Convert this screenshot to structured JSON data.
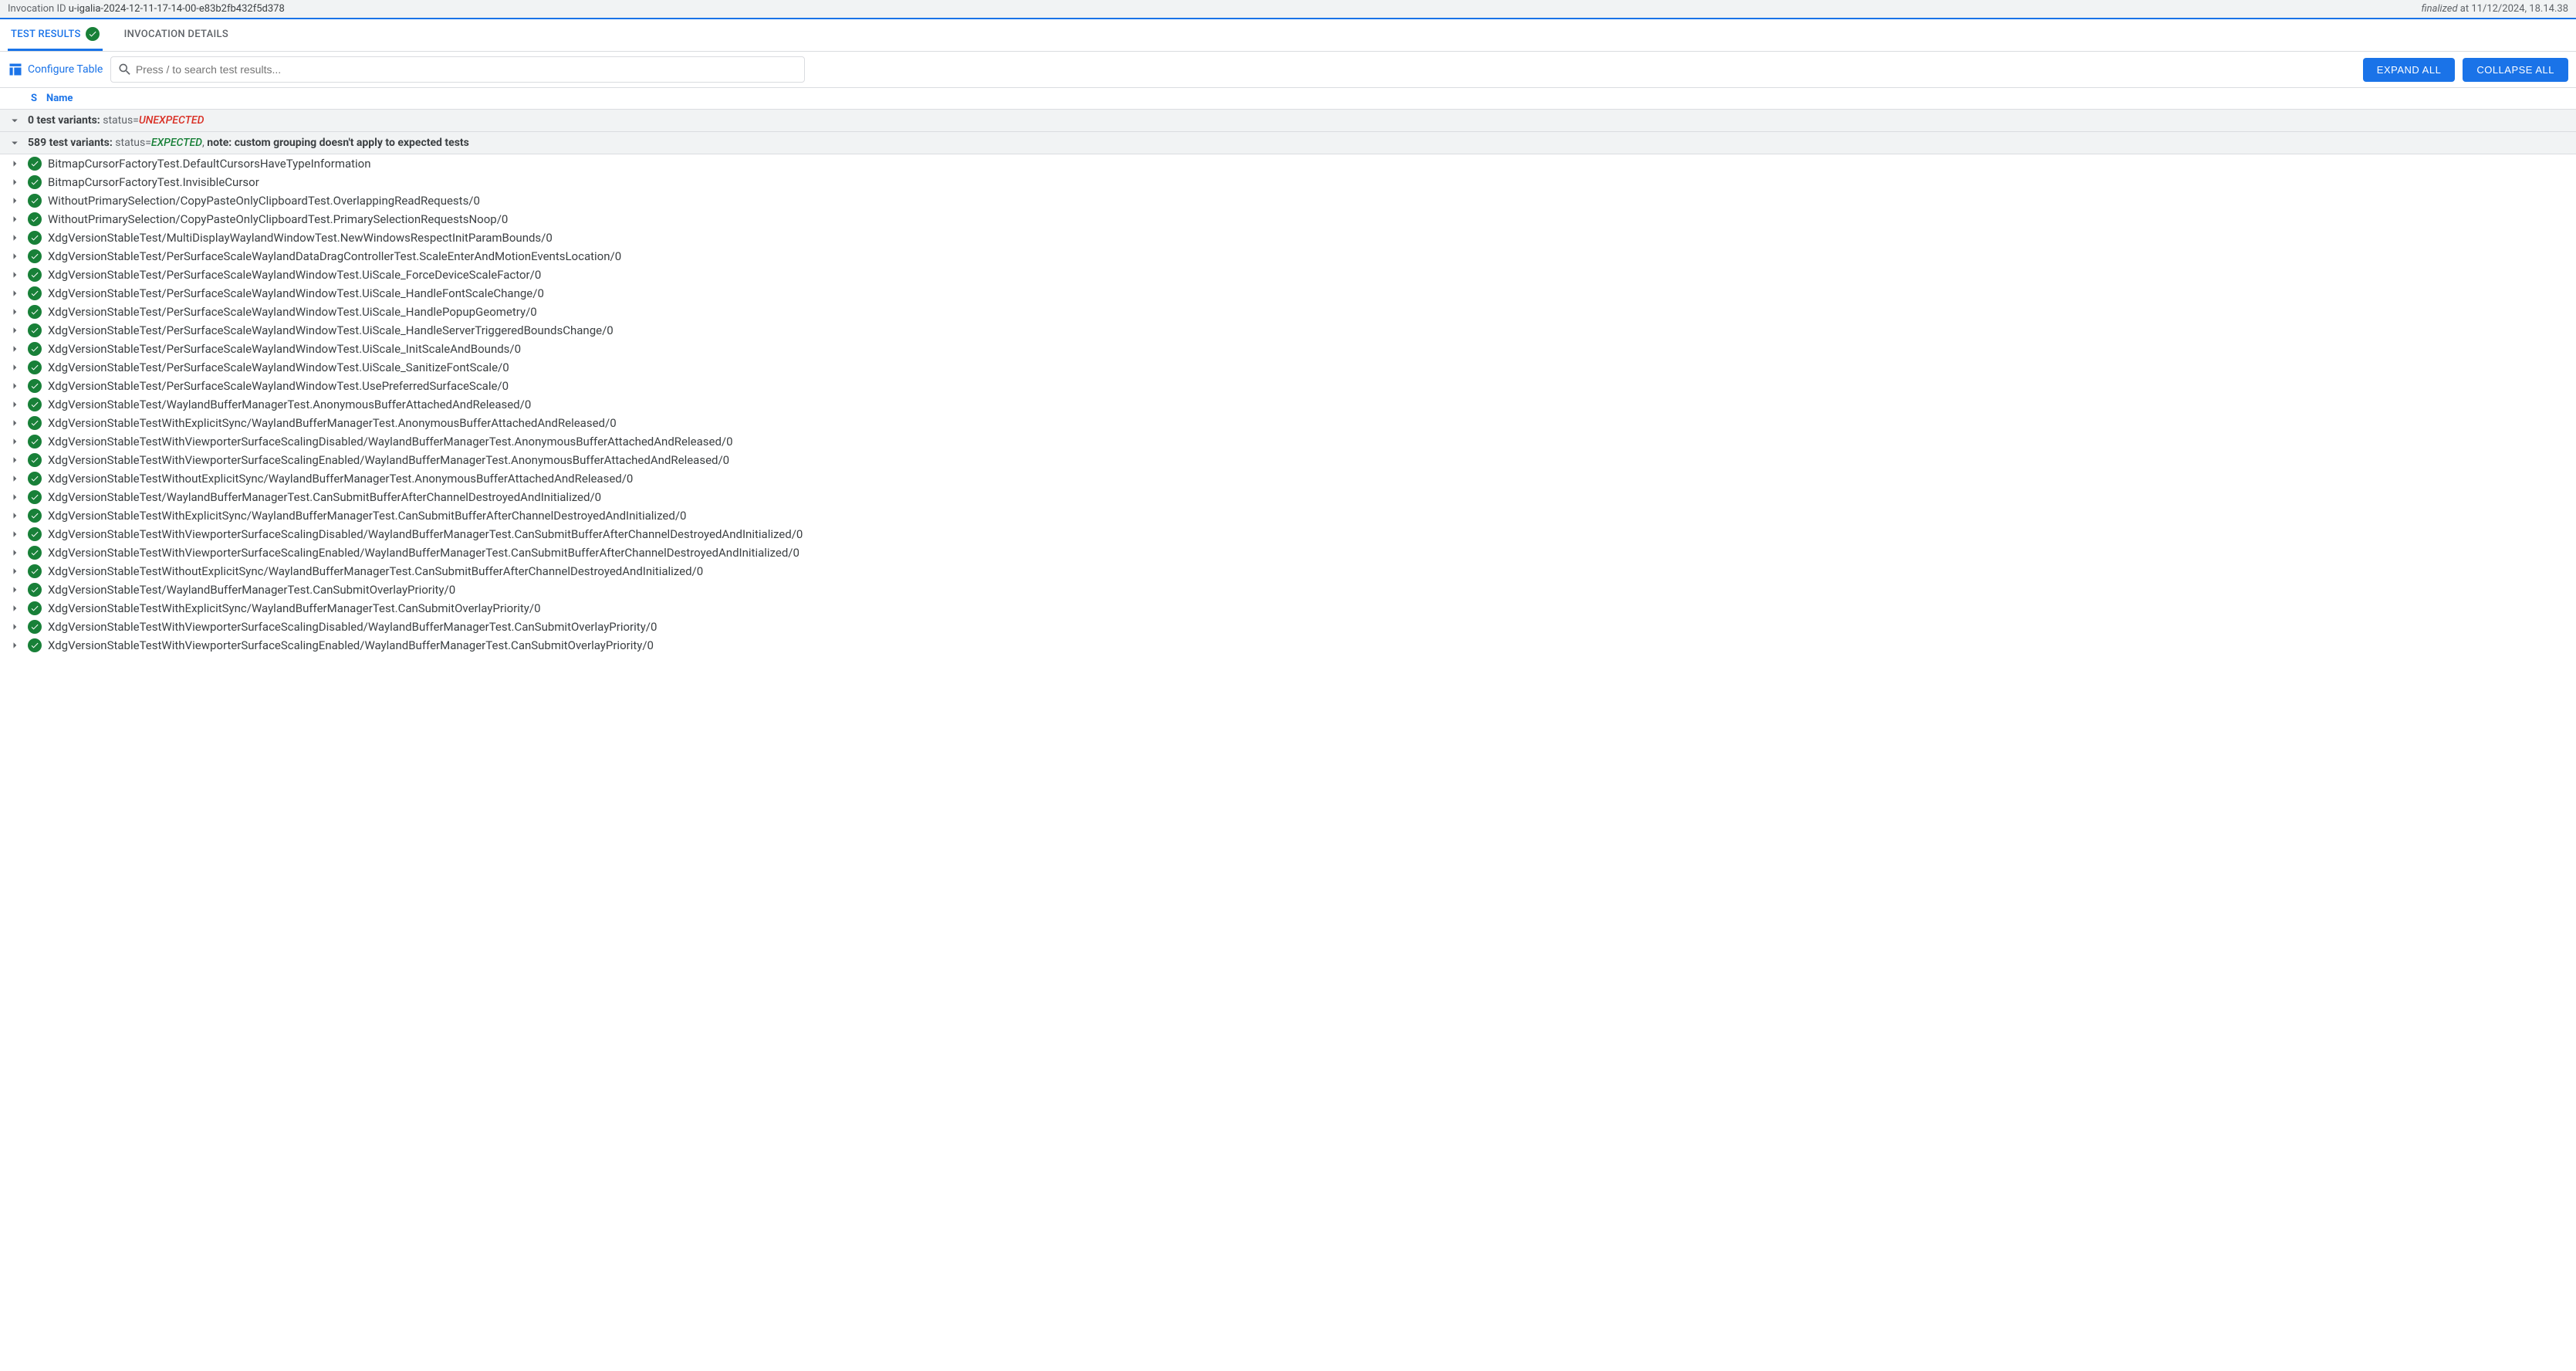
{
  "header": {
    "invocation_label": "Invocation ID",
    "invocation_id": "u-igalia-2024-12-11-17-14-00-e83b2fb432f5d378",
    "finalized_label": "finalized",
    "finalized_at_prefix": " at ",
    "finalized_at": "11/12/2024, 18.14.38"
  },
  "tabs": {
    "results": "TEST RESULTS",
    "details": "INVOCATION DETAILS"
  },
  "toolbar": {
    "configure": "Configure Table",
    "search_placeholder": "Press / to search test results...",
    "expand": "EXPAND ALL",
    "collapse": "COLLAPSE ALL"
  },
  "columns": {
    "s": "S",
    "name": "Name"
  },
  "groups": {
    "unexpected": {
      "count_label": "0 test variants:",
      "status_label": " status=",
      "status_value": "UNEXPECTED"
    },
    "expected": {
      "count_label": "589 test variants:",
      "status_label": " status=",
      "status_value": "EXPECTED",
      "note_sep": ", ",
      "note": "note: custom grouping doesn't apply to expected tests"
    }
  },
  "tests": [
    {
      "name": "BitmapCursorFactoryTest.DefaultCursorsHaveTypeInformation"
    },
    {
      "name": "BitmapCursorFactoryTest.InvisibleCursor"
    },
    {
      "name": "WithoutPrimarySelection/CopyPasteOnlyClipboardTest.OverlappingReadRequests/0"
    },
    {
      "name": "WithoutPrimarySelection/CopyPasteOnlyClipboardTest.PrimarySelectionRequestsNoop/0"
    },
    {
      "name": "XdgVersionStableTest/MultiDisplayWaylandWindowTest.NewWindowsRespectInitParamBounds/0"
    },
    {
      "name": "XdgVersionStableTest/PerSurfaceScaleWaylandDataDragControllerTest.ScaleEnterAndMotionEventsLocation/0"
    },
    {
      "name": "XdgVersionStableTest/PerSurfaceScaleWaylandWindowTest.UiScale_ForceDeviceScaleFactor/0"
    },
    {
      "name": "XdgVersionStableTest/PerSurfaceScaleWaylandWindowTest.UiScale_HandleFontScaleChange/0"
    },
    {
      "name": "XdgVersionStableTest/PerSurfaceScaleWaylandWindowTest.UiScale_HandlePopupGeometry/0"
    },
    {
      "name": "XdgVersionStableTest/PerSurfaceScaleWaylandWindowTest.UiScale_HandleServerTriggeredBoundsChange/0"
    },
    {
      "name": "XdgVersionStableTest/PerSurfaceScaleWaylandWindowTest.UiScale_InitScaleAndBounds/0"
    },
    {
      "name": "XdgVersionStableTest/PerSurfaceScaleWaylandWindowTest.UiScale_SanitizeFontScale/0"
    },
    {
      "name": "XdgVersionStableTest/PerSurfaceScaleWaylandWindowTest.UsePreferredSurfaceScale/0"
    },
    {
      "name": "XdgVersionStableTest/WaylandBufferManagerTest.AnonymousBufferAttachedAndReleased/0"
    },
    {
      "name": "XdgVersionStableTestWithExplicitSync/WaylandBufferManagerTest.AnonymousBufferAttachedAndReleased/0"
    },
    {
      "name": "XdgVersionStableTestWithViewporterSurfaceScalingDisabled/WaylandBufferManagerTest.AnonymousBufferAttachedAndReleased/0"
    },
    {
      "name": "XdgVersionStableTestWithViewporterSurfaceScalingEnabled/WaylandBufferManagerTest.AnonymousBufferAttachedAndReleased/0"
    },
    {
      "name": "XdgVersionStableTestWithoutExplicitSync/WaylandBufferManagerTest.AnonymousBufferAttachedAndReleased/0"
    },
    {
      "name": "XdgVersionStableTest/WaylandBufferManagerTest.CanSubmitBufferAfterChannelDestroyedAndInitialized/0"
    },
    {
      "name": "XdgVersionStableTestWithExplicitSync/WaylandBufferManagerTest.CanSubmitBufferAfterChannelDestroyedAndInitialized/0"
    },
    {
      "name": "XdgVersionStableTestWithViewporterSurfaceScalingDisabled/WaylandBufferManagerTest.CanSubmitBufferAfterChannelDestroyedAndInitialized/0"
    },
    {
      "name": "XdgVersionStableTestWithViewporterSurfaceScalingEnabled/WaylandBufferManagerTest.CanSubmitBufferAfterChannelDestroyedAndInitialized/0"
    },
    {
      "name": "XdgVersionStableTestWithoutExplicitSync/WaylandBufferManagerTest.CanSubmitBufferAfterChannelDestroyedAndInitialized/0"
    },
    {
      "name": "XdgVersionStableTest/WaylandBufferManagerTest.CanSubmitOverlayPriority/0"
    },
    {
      "name": "XdgVersionStableTestWithExplicitSync/WaylandBufferManagerTest.CanSubmitOverlayPriority/0"
    },
    {
      "name": "XdgVersionStableTestWithViewporterSurfaceScalingDisabled/WaylandBufferManagerTest.CanSubmitOverlayPriority/0"
    },
    {
      "name": "XdgVersionStableTestWithViewporterSurfaceScalingEnabled/WaylandBufferManagerTest.CanSubmitOverlayPriority/0"
    }
  ]
}
